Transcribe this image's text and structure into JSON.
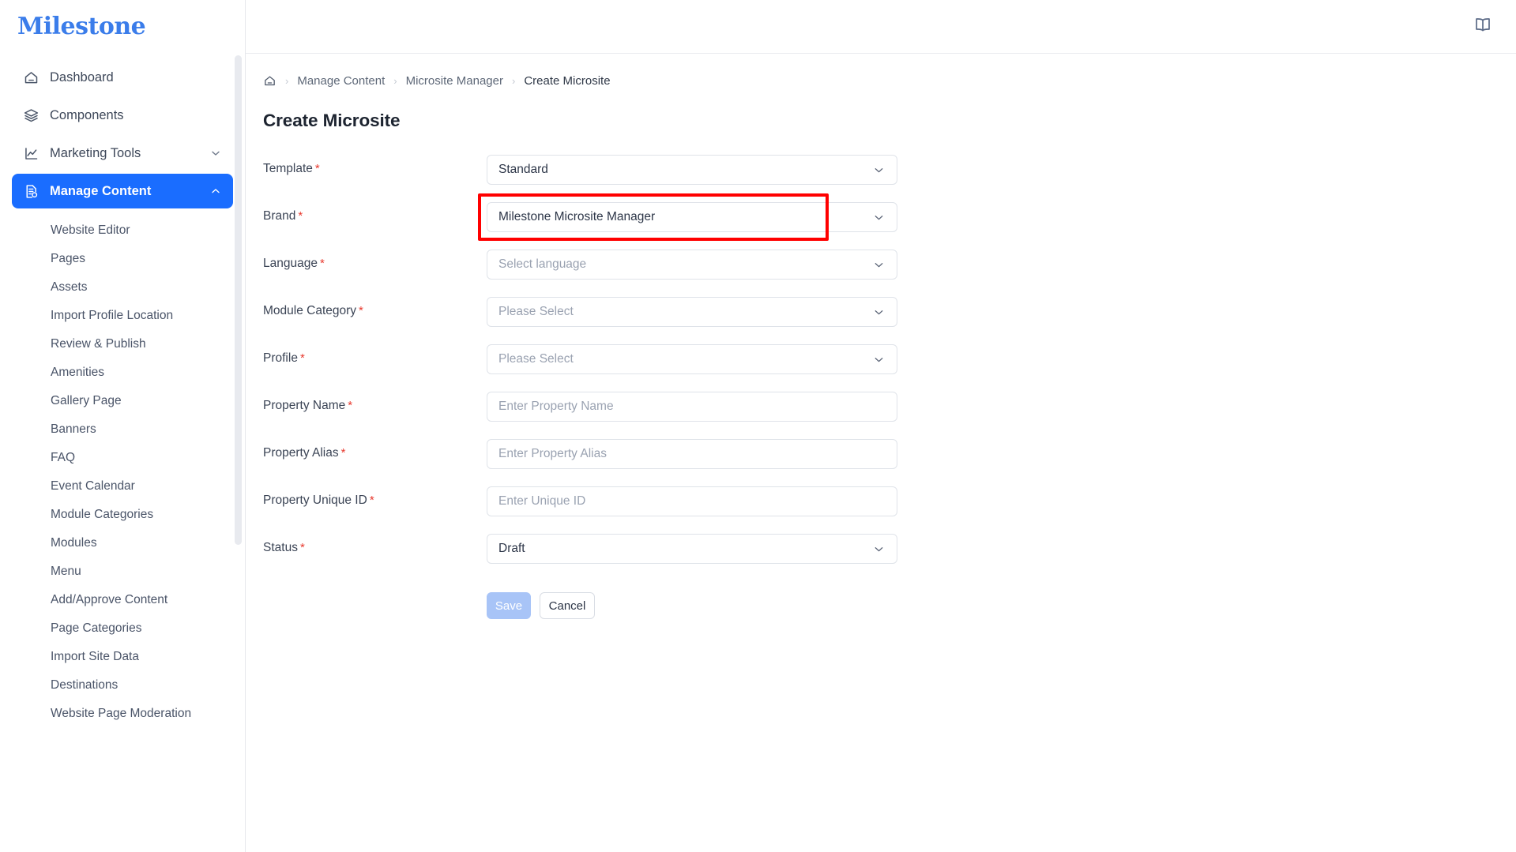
{
  "brand": {
    "logo_text": "Milestone",
    "accent_color": "#1a6dff",
    "logo_color": "#3b7dea"
  },
  "topbar": {
    "doc_icon": "book-icon"
  },
  "sidebar": {
    "items": [
      {
        "label": "Dashboard",
        "icon": "home-icon",
        "active": false,
        "expandable": false
      },
      {
        "label": "Components",
        "icon": "layers-icon",
        "active": false,
        "expandable": false
      },
      {
        "label": "Marketing Tools",
        "icon": "chart-line-icon",
        "active": false,
        "expandable": true,
        "chevron": "chevron-down-icon"
      },
      {
        "label": "Manage Content",
        "icon": "file-gear-icon",
        "active": true,
        "expandable": true,
        "chevron": "chevron-up-icon"
      }
    ],
    "sub_items": [
      {
        "label": "Website Editor"
      },
      {
        "label": "Pages"
      },
      {
        "label": "Assets"
      },
      {
        "label": "Import Profile Location"
      },
      {
        "label": "Review & Publish"
      },
      {
        "label": "Amenities"
      },
      {
        "label": "Gallery Page"
      },
      {
        "label": "Banners"
      },
      {
        "label": "FAQ"
      },
      {
        "label": "Event Calendar"
      },
      {
        "label": "Module Categories"
      },
      {
        "label": "Modules"
      },
      {
        "label": "Menu"
      },
      {
        "label": "Add/Approve Content"
      },
      {
        "label": "Page Categories"
      },
      {
        "label": "Import Site Data"
      },
      {
        "label": "Destinations"
      },
      {
        "label": "Website Page Moderation"
      }
    ]
  },
  "breadcrumb": {
    "home_icon": "home-icon",
    "separator": "›",
    "items": [
      {
        "label": "Manage Content"
      },
      {
        "label": "Microsite Manager"
      },
      {
        "label": "Create Microsite"
      }
    ]
  },
  "page": {
    "title": "Create Microsite"
  },
  "form": {
    "required_mark": "*",
    "fields": [
      {
        "label": "Template",
        "type": "select",
        "value": "Standard",
        "placeholder": "",
        "highlighted": false,
        "caret": "chevron-down-icon"
      },
      {
        "label": "Brand",
        "type": "select",
        "value": "Milestone Microsite Manager",
        "placeholder": "",
        "highlighted": true,
        "highlight_color": "#ff0000",
        "caret": "chevron-down-icon"
      },
      {
        "label": "Language",
        "type": "select",
        "value": "",
        "placeholder": "Select language",
        "highlighted": false,
        "caret": "chevron-down-icon"
      },
      {
        "label": "Module Category",
        "type": "select",
        "value": "",
        "placeholder": "Please Select",
        "highlighted": false,
        "caret": "chevron-down-icon"
      },
      {
        "label": "Profile",
        "type": "select",
        "value": "",
        "placeholder": "Please Select",
        "highlighted": false,
        "caret": "chevron-down-icon"
      },
      {
        "label": "Property Name",
        "type": "text",
        "value": "",
        "placeholder": "Enter Property Name",
        "highlighted": false
      },
      {
        "label": "Property Alias",
        "type": "text",
        "value": "",
        "placeholder": "Enter Property Alias",
        "highlighted": false
      },
      {
        "label": "Property Unique ID",
        "type": "text",
        "value": "",
        "placeholder": "Enter Unique ID",
        "highlighted": false
      },
      {
        "label": "Status",
        "type": "select",
        "value": "Draft",
        "placeholder": "",
        "highlighted": false,
        "caret": "chevron-down-icon"
      }
    ],
    "save_label": "Save",
    "cancel_label": "Cancel",
    "save_disabled": true
  }
}
